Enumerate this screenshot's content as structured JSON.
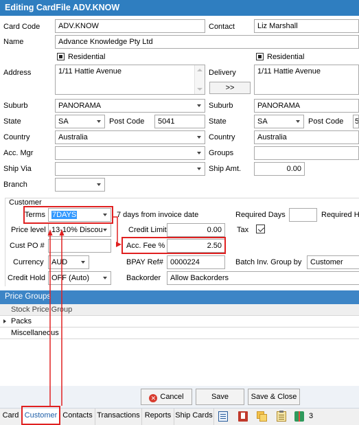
{
  "window": {
    "title": "Editing CardFile ADV.KNOW"
  },
  "card": {
    "card_code_label": "Card Code",
    "card_code": "ADV.KNOW",
    "contact_label": "Contact",
    "contact": "Liz Marshall",
    "name_label": "Name",
    "name": "Advance Knowledge Pty Ltd",
    "residential_label": "Residential",
    "address_label": "Address",
    "address": "1/11 Hattie Avenue",
    "delivery_label": "Delivery",
    "delivery": "1/11 Hattie Avenue",
    "copy_button": ">>",
    "suburb_label": "Suburb",
    "suburb": "PANORAMA",
    "delivery_suburb": "PANORAMA",
    "state_label": "State",
    "state": "SA",
    "delivery_state": "SA",
    "postcode_label": "Post Code",
    "postcode": "5041",
    "delivery_postcode": "5",
    "country_label": "Country",
    "country": "Australia",
    "delivery_country": "Australia",
    "acc_mgr_label": "Acc. Mgr",
    "acc_mgr": "",
    "groups_label": "Groups",
    "groups": "",
    "ship_via_label": "Ship Via",
    "ship_via": "",
    "ship_amt_label": "Ship Amt.",
    "ship_amt": "0.00",
    "branch_label": "Branch",
    "branch": ""
  },
  "customer": {
    "section_label": "Customer",
    "terms_label": "Terms",
    "terms": "7DAYS",
    "terms_desc": "7 days from invoice date",
    "required_days_label": "Required Days",
    "required_days": "",
    "required_h_label": "Required H",
    "price_level_label": "Price level",
    "price_level": "13-10% Discou",
    "credit_limit_label": "Credit Limit",
    "credit_limit": "0.00",
    "tax_label": "Tax",
    "tax_checked": true,
    "cust_po_label": "Cust PO #",
    "cust_po": "",
    "acc_fee_label": "Acc. Fee %",
    "acc_fee": "2.50",
    "currency_label": "Currency",
    "currency": "AUD",
    "bpay_label": "BPAY Ref#",
    "bpay": "0000224",
    "batch_inv_label": "Batch Inv. Group by",
    "batch_inv": "Customer",
    "credit_hold_label": "Credit Hold",
    "credit_hold": "OFF (Auto)",
    "backorder_label": "Backorder",
    "backorder": "Allow Backorders"
  },
  "price_groups": {
    "header": "Price Groups",
    "column": "Stock Price Group",
    "rows": [
      "Packs",
      "Miscellaneous"
    ]
  },
  "buttons": {
    "cancel": "Cancel",
    "save": "Save",
    "save_close": "Save & Close"
  },
  "tabs": [
    "Card",
    "Customer",
    "Contacts",
    "Transactions",
    "Reports",
    "Ship Cards"
  ],
  "active_tab": "Customer",
  "tab_badge": "3",
  "colors": {
    "title_bg": "#2f7ec0",
    "section_bg": "#3d85c6",
    "highlight_red": "#e02020",
    "selection_blue": "#3399ff"
  }
}
